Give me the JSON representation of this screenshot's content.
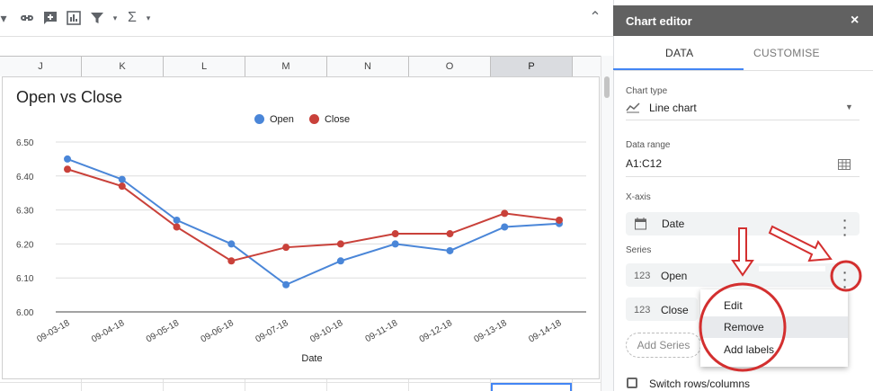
{
  "toolbar": {
    "icons": [
      "link-icon",
      "insert-comment-icon",
      "insert-chart-icon",
      "filter-icon",
      "functions-icon",
      "collapse-icon"
    ]
  },
  "sheet": {
    "columns": [
      "J",
      "K",
      "L",
      "M",
      "N",
      "O",
      "P"
    ],
    "selected_column": "P"
  },
  "chart_data": {
    "type": "line",
    "title": "Open vs Close",
    "xlabel": "Date",
    "ylabel": "",
    "categories": [
      "09-03-18",
      "09-04-18",
      "09-05-18",
      "09-06-18",
      "09-07-18",
      "09-10-18",
      "09-11-18",
      "09-12-18",
      "09-13-18",
      "09-14-18"
    ],
    "series": [
      {
        "name": "Open",
        "color": "#4a86d8",
        "values": [
          6.45,
          6.39,
          6.27,
          6.2,
          6.08,
          6.15,
          6.2,
          6.18,
          6.25,
          6.26
        ]
      },
      {
        "name": "Close",
        "color": "#c9413a",
        "values": [
          6.42,
          6.37,
          6.25,
          6.15,
          6.19,
          6.2,
          6.23,
          6.23,
          6.29,
          6.27
        ]
      }
    ],
    "yticks": [
      "6.50",
      "6.40",
      "6.30",
      "6.20",
      "6.10",
      "6.00"
    ],
    "ylim": [
      6.0,
      6.5
    ],
    "grid": true,
    "legend": "top"
  },
  "editor": {
    "title": "Chart editor",
    "close": "×",
    "tabs": [
      {
        "label": "DATA",
        "active": true
      },
      {
        "label": "CUSTOMISE",
        "active": false
      }
    ],
    "chart_type": {
      "label": "Chart type",
      "value": "Line chart"
    },
    "data_range": {
      "label": "Data range",
      "value": "A1:C12"
    },
    "x_axis": {
      "label": "X-axis",
      "value": "Date"
    },
    "series_label": "Series",
    "series": [
      {
        "icon_text": "123",
        "name": "Open"
      },
      {
        "icon_text": "123",
        "name": "Close"
      }
    ],
    "add_series": "Add Series",
    "switch_rows": "Switch rows/columns",
    "menu": [
      {
        "label": "Edit"
      },
      {
        "label": "Remove"
      },
      {
        "label": "Add labels"
      }
    ]
  },
  "annotation_color": "#d32f2f"
}
